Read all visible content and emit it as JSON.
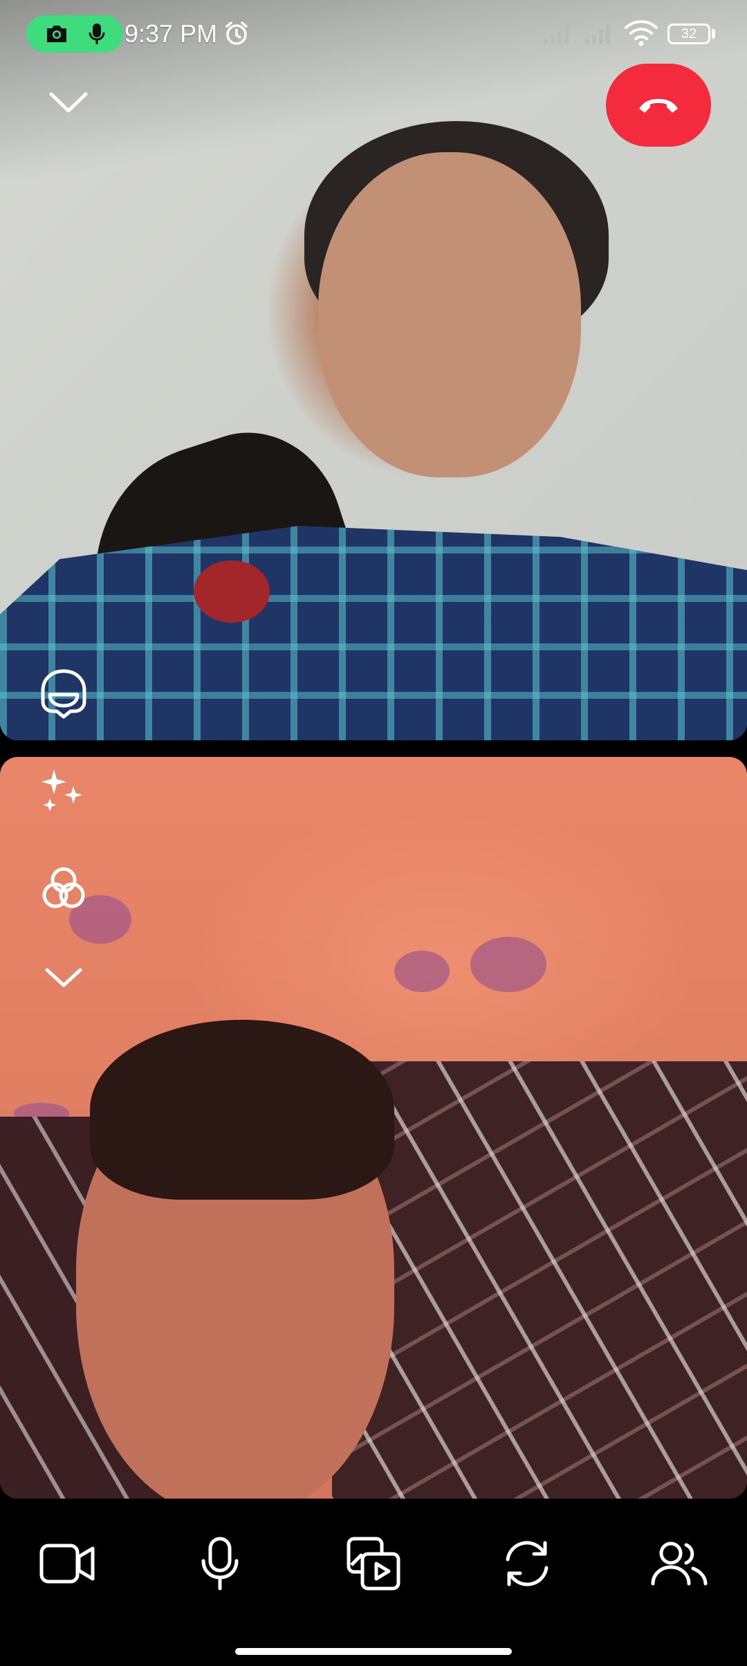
{
  "status_bar": {
    "time": "9:37 PM",
    "battery_level": "32",
    "icons": [
      "camera-icon",
      "microphone-icon",
      "alarm-icon",
      "signal-icon",
      "signal-icon",
      "wifi-icon",
      "battery-icon"
    ]
  },
  "call": {
    "top_controls": [
      "chevron-down-icon",
      "end-call-icon"
    ],
    "remote_overlay": [
      "avatar-effect-icon"
    ],
    "local_overlay": [
      "sparkle-effects-icon",
      "filters-icon",
      "chevron-down-icon"
    ],
    "end_call_color": "#f42a3d"
  },
  "toolbar": {
    "buttons": [
      "video-camera-icon",
      "microphone-icon",
      "share-media-icon",
      "switch-camera-icon",
      "add-people-icon"
    ]
  },
  "colors": {
    "recording_pill": "#3fdc7d",
    "end_call": "#f42a3d",
    "icon": "#ffffff",
    "toolbar_bg": "#000000"
  }
}
